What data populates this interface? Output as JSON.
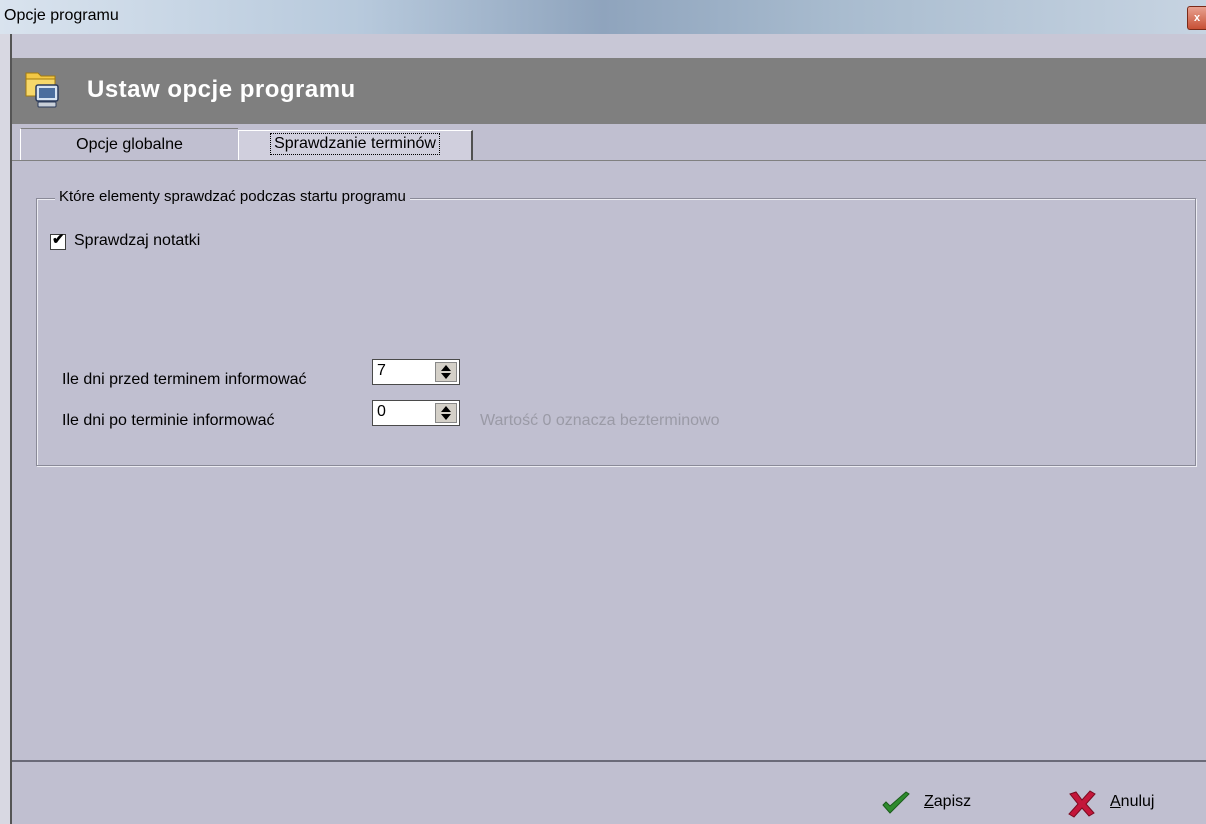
{
  "window": {
    "title": "Opcje programu",
    "close_glyph": "x"
  },
  "header": {
    "title": "Ustaw opcje programu",
    "icon": "folder-computer-icon"
  },
  "tabs": [
    {
      "label": "Opcje globalne",
      "active": false
    },
    {
      "label": "Sprawdzanie terminów",
      "active": true
    }
  ],
  "group": {
    "legend": "Które elementy sprawdzać podczas startu programu",
    "check_notes": {
      "label": "Sprawdzaj notatki",
      "checked": true,
      "glyph": "✔"
    },
    "days_before": {
      "label": "Ile dni przed terminem informować",
      "value": "7"
    },
    "days_after": {
      "label": "Ile dni po terminie informować",
      "value": "0"
    },
    "hint": "Wartość 0 oznacza bezterminowo"
  },
  "footer": {
    "save": {
      "accel": "Z",
      "rest": "apisz",
      "icon": "checkmark-icon",
      "color": "#2e8b2e"
    },
    "cancel": {
      "accel": "A",
      "rest": "nuluj",
      "icon": "cross-icon",
      "color": "#c4163a"
    }
  }
}
